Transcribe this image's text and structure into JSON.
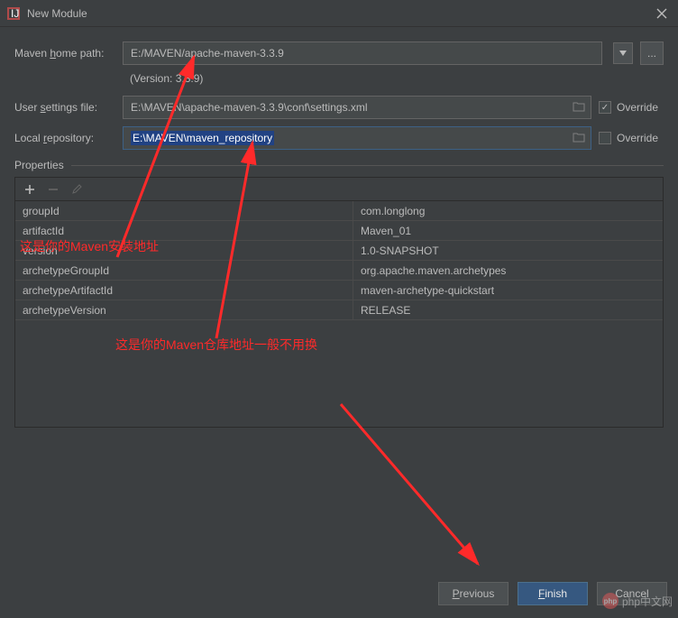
{
  "window": {
    "title": "New Module"
  },
  "form": {
    "home_label_pre": "Maven ",
    "home_label_u": "h",
    "home_label_post": "ome path:",
    "home_value": "E:/MAVEN/apache-maven-3.3.9",
    "version_pre": "(Version: ",
    "version_num": "3.3.9",
    "version_post": ")",
    "settings_label_pre": "User ",
    "settings_label_u": "s",
    "settings_label_post": "ettings file:",
    "settings_value": "E:\\MAVEN\\apache-maven-3.3.9\\conf\\settings.xml",
    "repo_label_pre": "Local ",
    "repo_label_u": "r",
    "repo_label_post": "epository:",
    "repo_value": "E:\\MAVEN\\maven_repository",
    "override_label": "Override",
    "settings_override_checked": true,
    "repo_override_checked": false
  },
  "properties": {
    "header": "Properties",
    "rows": [
      {
        "key": "groupId",
        "value": "com.longlong"
      },
      {
        "key": "artifactId",
        "value": "Maven_01"
      },
      {
        "key": "version",
        "value": "1.0-SNAPSHOT"
      },
      {
        "key": "archetypeGroupId",
        "value": "org.apache.maven.archetypes"
      },
      {
        "key": "archetypeArtifactId",
        "value": "maven-archetype-quickstart"
      },
      {
        "key": "archetypeVersion",
        "value": "RELEASE"
      }
    ]
  },
  "buttons": {
    "previous_u": "P",
    "previous_rest": "revious",
    "finish_u": "F",
    "finish_rest": "inish",
    "cancel": "Cancel"
  },
  "annotations": {
    "a1": "这是你的Maven安装地址",
    "a2": "这是你的Maven仓库地址一般不用换"
  },
  "watermark": "php中文网"
}
